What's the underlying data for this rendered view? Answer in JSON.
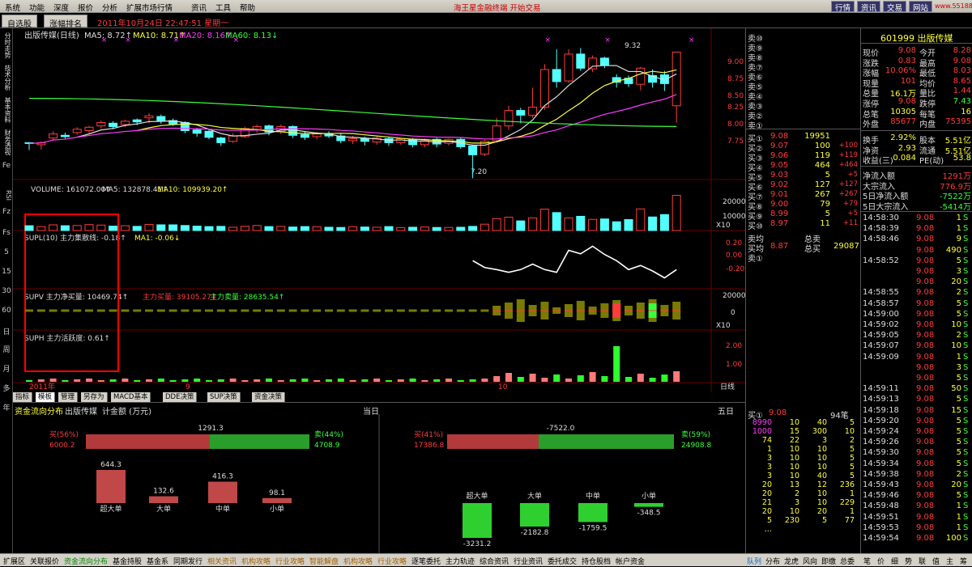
{
  "menu": {
    "items": [
      "系统",
      "功能",
      "深度",
      "报价",
      "分析",
      "扩展市场行情",
      "资讯",
      "工具",
      "帮助"
    ],
    "center": "海王星金融终端 开始交易",
    "right_tabs": [
      "行情",
      "资讯",
      "交易",
      "网站"
    ],
    "url": "www.55188.com"
  },
  "tabs": {
    "t1": "自选股",
    "t2": "涨幅排名",
    "datetime": "2011年10月24日  22:47:51 星期一"
  },
  "side": [
    "分时走势",
    "技术分析",
    "基本资料",
    "财务透视",
    "Fe",
    "RSI",
    "Fz",
    "Fs",
    "5",
    "15",
    "30",
    "60",
    "日",
    "周",
    "月",
    "多",
    "年"
  ],
  "chart_header": {
    "name": "出版传媒(日线)",
    "ma5": "MA5: 8.72↑",
    "ma10": "MA10: 8.71↑",
    "ma20": "MA20: 8.16↑",
    "ma60": "MA60: 8.13↓",
    "high_label": "9.32",
    "low_label": "7.20"
  },
  "vol_header": {
    "vol": "VOLUME: 161072.00↑",
    "ma5": "MA5: 132878.41↑",
    "ma10": "MA10: 109939.20↑"
  },
  "supl_header": {
    "t": "SUPL(10) 主力集散线: -0.18↑",
    "ma": "MA1: -0.06↓"
  },
  "supv_header": {
    "t": "SUPV 主力净买量: 10469.74↑",
    "buy": "主力买量: 39105.27↑",
    "sell": "主力卖量: 28635.54↑"
  },
  "suph_header": {
    "t": "SUPH 主力活跃度: 0.61↑"
  },
  "x_axis": {
    "year": "2011年",
    "m9": "9",
    "m10": "10",
    "period": "日线"
  },
  "price_axis": [
    "9.00",
    "8.75",
    "8.50",
    "8.25",
    "8.00",
    "7.75"
  ],
  "vol_axis": [
    "20000",
    "10000",
    "X10"
  ],
  "supl_axis": [
    "0.20",
    "0.00",
    "-0.20"
  ],
  "supv_axis": [
    "20000",
    "0",
    "X10"
  ],
  "suph_axis": [
    "2.00",
    "1.00"
  ],
  "bottom_tabs": [
    "指标",
    "模板",
    "管理",
    "另存为",
    "MACD基本",
    "DDE决策",
    "SUP决策",
    "资金决策"
  ],
  "fund": {
    "title": "资金流向分布",
    "stock": "出版传媒",
    "unit": "计金额 (万元)",
    "period_today": "当日",
    "period5": "五日",
    "left": {
      "net": "1291.3",
      "buy_label": "买(56%)",
      "buy_val": "6000.2",
      "sell_label": "卖(44%)",
      "sell_val": "4708.9"
    },
    "right": {
      "net": "-7522.0",
      "buy_label": "买(41%)",
      "buy_val": "17386.8",
      "sell_label": "卖(59%)",
      "sell_val": "24908.8"
    },
    "cats": [
      "超大单",
      "大单",
      "中单",
      "小单"
    ],
    "left_bars": [
      644.3,
      132.6,
      416.3,
      98.1
    ],
    "right_bars": [
      -3231.2,
      -2182.8,
      -1759.5,
      -348.5
    ]
  },
  "quote": {
    "code": "601999 出版传媒",
    "rows": [
      [
        "现价",
        "9.08",
        "今开",
        "8.28"
      ],
      [
        "涨跌",
        "0.83",
        "最高",
        "9.08"
      ],
      [
        "涨幅",
        "10.06%",
        "最低",
        "8.03"
      ],
      [
        "现量",
        "101",
        "均价",
        "8.65"
      ],
      [
        "总量",
        "16.1万",
        "量比",
        "1.44"
      ],
      [
        "涨停",
        "9.08",
        "跌停",
        "7.43"
      ],
      [
        "总笔",
        "10305",
        "每笔",
        "16"
      ],
      [
        "外盘",
        "85677",
        "内盘",
        "75395"
      ]
    ],
    "rows2": [
      [
        "换手",
        "2.92%",
        "股本",
        "5.51亿"
      ],
      [
        "净资",
        "2.93",
        "流通",
        "5.51亿"
      ],
      [
        "收益(三)",
        "0.084",
        "PE(动)",
        "53.8"
      ]
    ],
    "flows": [
      [
        "净流入额",
        "1291万"
      ],
      [
        "大宗流入",
        "776.9万"
      ],
      [
        "5日净流入额",
        "-7522万"
      ],
      [
        "5日大宗流入",
        "-5414万"
      ]
    ]
  },
  "sell_levels": [
    "卖⑩",
    "卖⑨",
    "卖⑧",
    "卖⑦",
    "卖⑥",
    "卖⑤",
    "卖④",
    "卖③",
    "卖②",
    "卖①"
  ],
  "buy_levels": [
    [
      "买①",
      "9.08",
      "19951",
      ""
    ],
    [
      "买②",
      "9.07",
      "100",
      "+100"
    ],
    [
      "买③",
      "9.06",
      "119",
      "+119"
    ],
    [
      "买④",
      "9.05",
      "464",
      "+464"
    ],
    [
      "买⑤",
      "9.03",
      "5",
      "+5"
    ],
    [
      "买⑥",
      "9.02",
      "127",
      "+127"
    ],
    [
      "买⑦",
      "9.01",
      "267",
      "+267"
    ],
    [
      "买⑧",
      "9.00",
      "79",
      "+79"
    ],
    [
      "买⑨",
      "8.99",
      "5",
      "+5"
    ],
    [
      "买⑩",
      "8.97",
      "11",
      "+11"
    ]
  ],
  "summary": {
    "l1": "卖均",
    "l1b": "总卖",
    "l2": "买均",
    "l2v": "8.87",
    "l2b": "总买",
    "l2bv": "29087",
    "l3": "卖①"
  },
  "queue": {
    "label": "买①",
    "price": "9.08",
    "count": "94笔",
    "rows": [
      [
        "8990",
        "10",
        "40",
        "5"
      ],
      [
        "1000",
        "15",
        "300",
        "10"
      ],
      [
        "74",
        "22",
        "3",
        "2"
      ],
      [
        "1",
        "10",
        "10",
        "5"
      ],
      [
        "3",
        "10",
        "10",
        "5"
      ],
      [
        "3",
        "10",
        "10",
        "5"
      ],
      [
        "3",
        "10",
        "40",
        "5"
      ],
      [
        "20",
        "13",
        "12",
        "236"
      ],
      [
        "20",
        "2",
        "10",
        "1"
      ],
      [
        "21",
        "3",
        "10",
        "229"
      ],
      [
        "20",
        "10",
        "20",
        "1"
      ],
      [
        "5",
        "230",
        "5",
        "77"
      ],
      [
        "…",
        "",
        "",
        ""
      ]
    ]
  },
  "ticks": [
    [
      "14:58:30",
      "9.08",
      "1",
      "S"
    ],
    [
      "14:58:39",
      "9.08",
      "1",
      "S"
    ],
    [
      "14:58:46",
      "9.08",
      "9",
      "S"
    ],
    [
      "",
      "9.08",
      "490",
      "S"
    ],
    [
      "14:58:52",
      "9.08",
      "5",
      "S"
    ],
    [
      "",
      "9.08",
      "3",
      "S"
    ],
    [
      "",
      "9.08",
      "20",
      "S"
    ],
    [
      "14:58:55",
      "9.08",
      "2",
      "S"
    ],
    [
      "14:58:57",
      "9.08",
      "5",
      "S"
    ],
    [
      "14:59:00",
      "9.08",
      "5",
      "S"
    ],
    [
      "14:59:02",
      "9.08",
      "10",
      "S"
    ],
    [
      "14:59:05",
      "9.08",
      "2",
      "S"
    ],
    [
      "14:59:07",
      "9.08",
      "10",
      "S"
    ],
    [
      "14:59:09",
      "9.08",
      "1",
      "S"
    ],
    [
      "",
      "9.08",
      "3",
      "S"
    ],
    [
      "",
      "9.08",
      "5",
      "S"
    ],
    [
      "14:59:11",
      "9.08",
      "50",
      "S"
    ],
    [
      "14:59:13",
      "9.08",
      "5",
      "S"
    ],
    [
      "14:59:18",
      "9.08",
      "15",
      "S"
    ],
    [
      "14:59:20",
      "9.08",
      "5",
      "S"
    ],
    [
      "14:59:24",
      "9.08",
      "5",
      "S"
    ],
    [
      "14:59:26",
      "9.08",
      "5",
      "S"
    ],
    [
      "14:59:30",
      "9.08",
      "5",
      "S"
    ],
    [
      "14:59:34",
      "9.08",
      "5",
      "S"
    ],
    [
      "14:59:38",
      "9.08",
      "2",
      "S"
    ],
    [
      "14:59:43",
      "9.08",
      "20",
      "S"
    ],
    [
      "14:59:46",
      "9.08",
      "5",
      "S"
    ],
    [
      "14:59:48",
      "9.08",
      "1",
      "S"
    ],
    [
      "14:59:51",
      "9.08",
      "1",
      "S"
    ],
    [
      "14:59:53",
      "9.08",
      "1",
      "S"
    ],
    [
      "14:59:54",
      "9.08",
      "100",
      "S"
    ]
  ],
  "bottom_nav": [
    "扩展区",
    "关联报价",
    "资金流向分布",
    "基金持股",
    "基金系",
    "同期发行",
    "相关资讯",
    "机构攻略",
    "行业攻略",
    "智能解盘",
    "机构攻略",
    "行业攻略",
    "逐笔委托",
    "主力轨迹",
    "综合资讯",
    "行业资讯",
    "委托成交",
    "持仓股档",
    "帐户资金"
  ],
  "right_nav": [
    "队列",
    "分布",
    "龙虎",
    "风向",
    "即缴",
    "总委"
  ],
  "right_nav2": [
    "笔",
    "价",
    "细",
    "势",
    "联",
    "值",
    "主",
    "筹"
  ],
  "chart_data": {
    "type": "candlestick",
    "candles": [
      [
        7.73,
        7.72,
        7.62,
        7.74
      ],
      [
        7.7,
        7.73,
        7.63,
        7.75
      ],
      [
        7.8,
        7.86,
        7.76,
        7.9
      ],
      [
        7.84,
        7.82,
        7.79,
        7.88
      ],
      [
        7.88,
        7.93,
        7.85,
        7.96
      ],
      [
        7.91,
        7.96,
        7.87,
        7.98
      ],
      [
        7.98,
        8.03,
        7.94,
        8.06
      ],
      [
        8.02,
        7.97,
        7.93,
        8.05
      ],
      [
        8.0,
        8.05,
        7.96,
        8.07
      ],
      [
        8.07,
        8.04,
        7.99,
        8.09
      ],
      [
        8.1,
        8.13,
        8.02,
        8.17
      ],
      [
        8.12,
        8.05,
        8.01,
        8.15
      ],
      [
        8.06,
        8.01,
        7.98,
        8.09
      ],
      [
        8.03,
        7.91,
        7.87,
        8.05
      ],
      [
        7.92,
        7.87,
        7.82,
        7.95
      ],
      [
        7.9,
        7.81,
        7.78,
        7.93
      ],
      [
        7.8,
        7.73,
        7.68,
        7.82
      ],
      [
        7.75,
        7.83,
        7.73,
        7.87
      ],
      [
        7.82,
        7.94,
        7.8,
        7.97
      ],
      [
        7.93,
        7.97,
        7.88,
        8.0
      ],
      [
        7.98,
        7.89,
        7.84,
        8.0
      ],
      [
        7.9,
        7.97,
        7.86,
        8.0
      ],
      [
        7.97,
        7.84,
        7.8,
        7.99
      ],
      [
        7.85,
        7.81,
        7.77,
        7.9
      ],
      [
        7.82,
        7.86,
        7.78,
        7.89
      ],
      [
        7.86,
        7.83,
        7.8,
        7.9
      ],
      [
        7.83,
        7.76,
        7.72,
        7.86
      ],
      [
        7.76,
        7.79,
        7.71,
        7.83
      ],
      [
        7.79,
        7.75,
        7.69,
        7.82
      ],
      [
        7.74,
        7.8,
        7.7,
        7.82
      ],
      [
        7.79,
        7.73,
        7.68,
        7.82
      ],
      [
        7.73,
        7.79,
        7.7,
        7.8
      ],
      [
        7.78,
        7.7,
        7.66,
        7.8
      ],
      [
        7.7,
        7.76,
        7.66,
        7.79
      ],
      [
        7.78,
        7.71,
        7.66,
        7.8
      ],
      [
        7.72,
        7.78,
        7.69,
        7.79
      ],
      [
        7.78,
        7.67,
        7.64,
        7.8
      ],
      [
        7.68,
        7.55,
        7.2,
        7.7
      ],
      [
        7.56,
        7.75,
        7.53,
        7.77
      ],
      [
        7.76,
        7.98,
        7.74,
        8.1
      ],
      [
        7.98,
        8.21,
        7.92,
        8.28
      ],
      [
        8.21,
        8.14,
        8.02,
        8.25
      ],
      [
        8.14,
        8.26,
        8.1,
        8.55
      ],
      [
        8.26,
        8.82,
        8.22,
        8.9
      ],
      [
        8.82,
        8.64,
        8.55,
        9.12
      ],
      [
        8.65,
        9.05,
        8.62,
        9.12
      ],
      [
        9.05,
        8.84,
        8.8,
        9.14
      ],
      [
        8.83,
        8.99,
        8.78,
        9.03
      ],
      [
        8.99,
        8.88,
        8.84,
        9.01
      ],
      [
        8.7,
        8.63,
        8.55,
        8.75
      ],
      [
        8.69,
        8.61,
        8.56,
        8.73
      ],
      [
        8.6,
        8.84,
        8.51,
        8.86
      ],
      [
        8.73,
        8.63,
        8.55,
        8.82
      ],
      [
        8.74,
        8.61,
        8.5,
        8.8
      ],
      [
        8.28,
        9.08,
        8.03,
        9.08
      ]
    ],
    "volumes": [
      2.2,
      1.8,
      2.6,
      2.2,
      2.3,
      2.7,
      2.5,
      2.0,
      2.2,
      1.9,
      2.8,
      2.6,
      2.6,
      2.3,
      2.0,
      1.8,
      1.9,
      1.5,
      1.9,
      2.3,
      1.8,
      1.9,
      1.6,
      1.8,
      1.7,
      1.5,
      1.4,
      1.7,
      1.6,
      1.5,
      1.8,
      1.3,
      1.5,
      1.6,
      1.4,
      1.4,
      1.5,
      1.9,
      2.9,
      5.4,
      6.1,
      4.4,
      5.8,
      9.8,
      8.2,
      5.8,
      6.5,
      5.1,
      5.3,
      4.0,
      5.0,
      9.9,
      6.2,
      7.3,
      16.1
    ],
    "supl": [
      null,
      null,
      null,
      null,
      null,
      null,
      null,
      null,
      null,
      null,
      null,
      null,
      null,
      null,
      null,
      null,
      null,
      null,
      null,
      null,
      null,
      null,
      null,
      null,
      null,
      null,
      null,
      null,
      null,
      null,
      null,
      null,
      null,
      null,
      null,
      null,
      null,
      null,
      null,
      null,
      null,
      null,
      null,
      -0.05,
      -0.15,
      -0.18,
      -0.22,
      -0.18,
      -0.1,
      -0.18,
      -0.22,
      0.1,
      0.05,
      0.16,
      0.04,
      -0.05,
      -0.18,
      -0.12,
      -0.2,
      -0.3,
      -0.18
    ]
  }
}
